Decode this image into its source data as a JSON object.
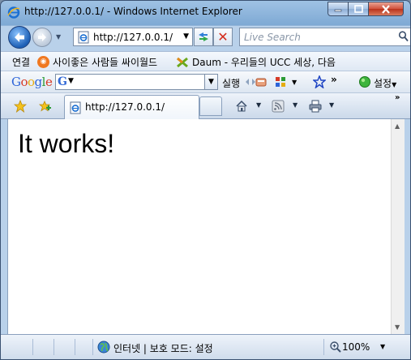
{
  "window": {
    "title": "http://127.0.0.1/ - Windows Internet Explorer"
  },
  "address_bar": {
    "url": "http://127.0.0.1/",
    "search_placeholder": "Live Search"
  },
  "links_bar": {
    "label": "연결",
    "items": [
      {
        "label": "사이좋은 사람들 싸이월드",
        "icon": "cyworld-icon"
      },
      {
        "label": "Daum - 우리들의 UCC 세상, 다음",
        "icon": "daum-icon"
      }
    ]
  },
  "google_toolbar": {
    "logo": "Google",
    "search_button": "실행",
    "more": "»",
    "settings": "설정"
  },
  "tab_bar": {
    "tab_title": "http://127.0.0.1/",
    "chevron": "»"
  },
  "page": {
    "heading": "It works!"
  },
  "status_bar": {
    "zone": "인터넷 | 보호 모드: 설정",
    "zoom": "100%"
  },
  "colors": {
    "frame": "#9fc2e4",
    "close_button": "#d0503a",
    "content_background": "#ffffff"
  }
}
